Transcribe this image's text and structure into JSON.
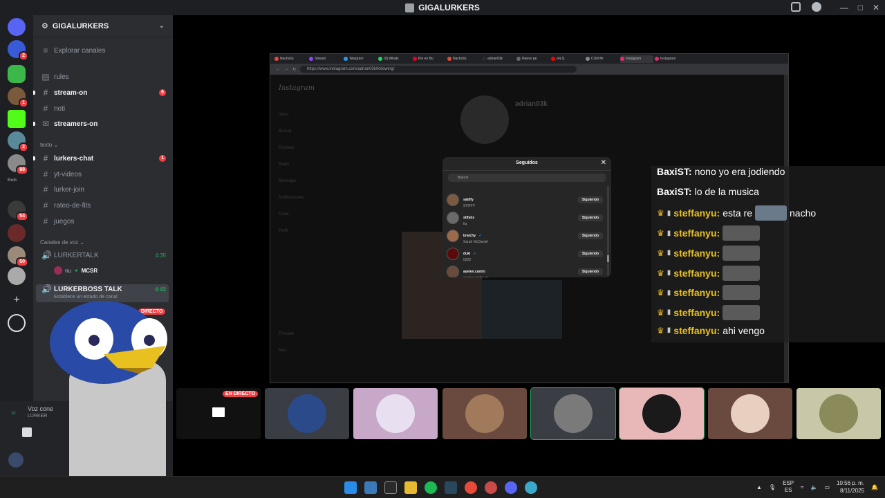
{
  "app": {
    "title": "GIGALURKERS"
  },
  "server": {
    "name": "GIGALURKERS",
    "explore": "Explorar canales"
  },
  "guild_badges": {
    "g1": "2",
    "g2": "1",
    "g3": "2",
    "g4": "88",
    "g5": "54",
    "g6": "50"
  },
  "guild_label": "Exds",
  "channels": {
    "rules": "rules",
    "stream_on": "stream-on",
    "stream_on_badge": "6",
    "noti": "noti",
    "streamers_on": "streamers-on",
    "cat_text": "texto",
    "lurkers_chat": "lurkers-chat",
    "lurkers_chat_badge": "1",
    "yt_videos": "yt-videos",
    "lurker_join": "lurker-join",
    "rateo_de_fits": "rateo-de-fits",
    "juegos": "juegos",
    "cat_voice": "Canales de voz",
    "lurkertalk": "LURKERTALK",
    "lurkertalk_time": "4:35",
    "lurkertalk_user_prefix": "nu",
    "lurkertalk_user": "MCSR",
    "lurkerboss": "LURKERBOSS TALK",
    "lurkerboss_time": "4:42",
    "lurkerboss_status": "Establece un estado de canal",
    "live": "DIRECTO"
  },
  "voice_panel": {
    "status": "Voz cone",
    "channel": "LURKER"
  },
  "browser": {
    "tabs": [
      "NachoGi",
      "Stream",
      "Telegram",
      "(9) Whats",
      "Pin en Bu",
      "NachoGi",
      "adrian03k",
      "Nuevo pe",
      "(4) Q",
      "CUN Mi",
      "Instagram",
      "Instagram"
    ],
    "url": "https://www.instagram.com/adrian03k/following/"
  },
  "instagram": {
    "logo": "Instagram",
    "nav": [
      "Inicio",
      "Buscar",
      "Explorar",
      "Reels",
      "Mensajes",
      "Notificaciones",
      "Crear",
      "Perfil",
      "Threads",
      "Más"
    ],
    "profile_name": "adrian03k",
    "modal": {
      "title": "Seguidos",
      "search_placeholder": "Buscar",
      "rows": [
        {
          "user": "satiffy",
          "sub": "STIFFY",
          "verified": false,
          "button": "Siguiendo",
          "color": "#7a5a40"
        },
        {
          "user": "stifyds",
          "sub": "tiu",
          "verified": false,
          "button": "Siguiendo",
          "color": "#6a6a6a"
        },
        {
          "user": "bratchy",
          "sub": "Sarah McDaniel",
          "verified": true,
          "button": "Siguiendo",
          "color": "#9a6a4a"
        },
        {
          "user": "duki",
          "sub": "5202",
          "verified": true,
          "button": "Siguiendo",
          "color": "#5a0a0a"
        },
        {
          "user": "ayelen.castro",
          "sub": "ayelen.castro.ga",
          "verified": false,
          "button": "Siguiendo",
          "color": "#6a4a3a"
        }
      ]
    }
  },
  "chat": {
    "messages": [
      {
        "user": "BaxiST",
        "user_color": "#ffffff",
        "text": "nono yo era jodiendo",
        "badges": false,
        "emotes": 0
      },
      {
        "user": "BaxiST",
        "user_color": "#ffffff",
        "text": "lo de la musica",
        "badges": false,
        "emotes": 0
      },
      {
        "user": "steffanyu",
        "user_color": "#e8c020",
        "text": "esta re",
        "text_after": "nacho",
        "badges": true,
        "emotes": 1,
        "face": true
      },
      {
        "user": "steffanyu",
        "user_color": "#e8c020",
        "text": "",
        "badges": true,
        "emotes": 1
      },
      {
        "user": "steffanyu",
        "user_color": "#e8c020",
        "text": "",
        "badges": true,
        "emotes": 1
      },
      {
        "user": "steffanyu",
        "user_color": "#e8c020",
        "text": "",
        "badges": true,
        "emotes": 1
      },
      {
        "user": "steffanyu",
        "user_color": "#e8c020",
        "text": "",
        "badges": true,
        "emotes": 1
      },
      {
        "user": "steffanyu",
        "user_color": "#e8c020",
        "text": "",
        "badges": true,
        "emotes": 1
      },
      {
        "user": "steffanyu",
        "user_color": "#e8c020",
        "text": "ahi vengo",
        "badges": true,
        "emotes": 0
      }
    ]
  },
  "participants": {
    "live_label": "EN DIRECTO",
    "tiles": [
      {
        "name": "participant-screen-share",
        "bg": "#111111",
        "circle": ""
      },
      {
        "name": "participant-2",
        "bg": "#3a3d44",
        "circle": "#2a4a8a"
      },
      {
        "name": "participant-3",
        "bg": "#c8a8c8",
        "circle": "#e8e0f0"
      },
      {
        "name": "participant-4",
        "bg": "#6a4a3e",
        "circle": "#a07a5a"
      },
      {
        "name": "participant-5",
        "bg": "#3a3d44",
        "circle": "#7a7a7a"
      },
      {
        "name": "participant-6",
        "bg": "#e8b8b8",
        "circle": "#1a1a1a"
      },
      {
        "name": "participant-7",
        "bg": "#6a4a3e",
        "circle": "#e8d0c0"
      },
      {
        "name": "participant-8",
        "bg": "#c8c8a8",
        "circle": "#8a8a5a"
      }
    ]
  },
  "taskbar": {
    "lang": "ESP",
    "lang_sub": "ES",
    "time": "10:56 p. m.",
    "date": "8/11/2025"
  },
  "colors": {
    "accent_green": "#23a55a",
    "badge_red": "#f23f43",
    "crown_gold": "#e8b320"
  }
}
